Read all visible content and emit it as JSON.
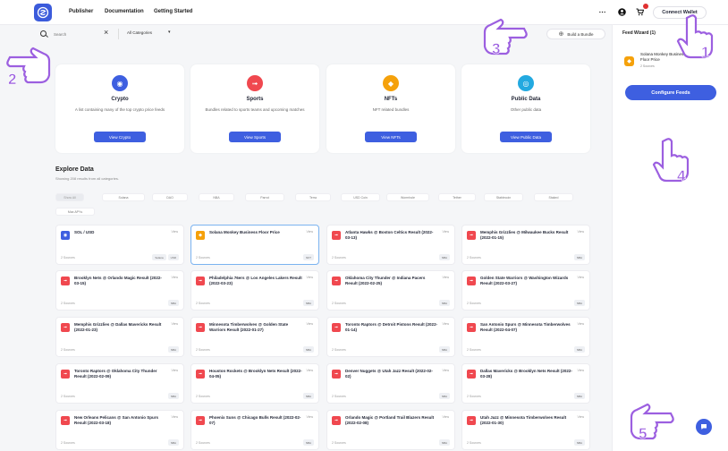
{
  "header": {
    "nav": [
      "Publisher",
      "Documentation",
      "Getting Started"
    ],
    "more_icon": "more-icon",
    "account_icon": "account-icon",
    "cart_icon": "cart-icon",
    "connect_label": "Connect Wallet"
  },
  "search": {
    "placeholder": "Search",
    "category_label": "All Categories"
  },
  "bundle_label": "Build a Bundle",
  "wizard": {
    "title": "Feed Wizard (1)",
    "item_name": "Solana Monkey Business Floor Price",
    "item_sources": "2 Sources",
    "configure_label": "Configure Feeds"
  },
  "categories": [
    {
      "title": "Crypto",
      "desc": "A list containing many of the top crypto price feeds",
      "button": "View Crypto",
      "color": "#3e5fe0",
      "icon": "crypto-icon"
    },
    {
      "title": "Sports",
      "desc": "Bundles related to sports teams and upcoming matches",
      "button": "View Sports",
      "color": "#f0484f",
      "icon": "sports-icon"
    },
    {
      "title": "NFTs",
      "desc": "NFT related bundles",
      "button": "View NFTs",
      "color": "#f5a10b",
      "icon": "nft-icon"
    },
    {
      "title": "Public Data",
      "desc": "Other public data",
      "button": "View Public Data",
      "color": "#23a9e0",
      "icon": "globe-icon"
    }
  ],
  "explore": {
    "title": "Explore Data",
    "subtitle": "Showing 208 results from all categories.",
    "filters": [
      "Show All",
      "Solana",
      "DAO",
      "NBA",
      "Parrot",
      "Terra",
      "USD Coin",
      "Wormhole",
      "Tether",
      "Stablecoin",
      "Staked",
      "Max APYs"
    ]
  },
  "cards": [
    {
      "name": "SOL / USD",
      "sources": "2 Sources",
      "tags": [
        "Solana",
        "USD"
      ],
      "color": "#3e5fe0",
      "selected": false
    },
    {
      "name": "Solana Monkey Business Floor Price",
      "sources": "2 Sources",
      "tags": [
        "NFT"
      ],
      "color": "#f5a10b",
      "selected": true
    },
    {
      "name": "Atlanta Hawks @ Boston Celtics Result (2022-03-13)",
      "sources": "2 Sources",
      "tags": [
        "NBA"
      ],
      "color": "#f0484f",
      "selected": false
    },
    {
      "name": "Memphis Grizzlies @ Milwaukee Bucks Result (2022-01-15)",
      "sources": "2 Sources",
      "tags": [
        "NBA"
      ],
      "color": "#f0484f",
      "selected": false
    },
    {
      "name": "Brooklyn Nets @ Orlando Magic Result (2022-03-15)",
      "sources": "2 Sources",
      "tags": [
        "NBA"
      ],
      "color": "#f0484f",
      "selected": false
    },
    {
      "name": "Philadelphia 76ers @ Los Angeles Lakers Result (2022-03-23)",
      "sources": "2 Sources",
      "tags": [
        "NBA"
      ],
      "color": "#f0484f",
      "selected": false
    },
    {
      "name": "Oklahoma City Thunder @ Indiana Pacers Result (2022-02-25)",
      "sources": "2 Sources",
      "tags": [
        "NBA"
      ],
      "color": "#f0484f",
      "selected": false
    },
    {
      "name": "Golden State Warriors @ Washington Wizards Result (2022-03-27)",
      "sources": "2 Sources",
      "tags": [
        "NBA"
      ],
      "color": "#f0484f",
      "selected": false
    },
    {
      "name": "Memphis Grizzlies @ Dallas Mavericks Result (2022-01-23)",
      "sources": "2 Sources",
      "tags": [
        "NBA"
      ],
      "color": "#f0484f",
      "selected": false
    },
    {
      "name": "Minnesota Timberwolves @ Golden State Warriors Result (2022-01-27)",
      "sources": "2 Sources",
      "tags": [
        "NBA"
      ],
      "color": "#f0484f",
      "selected": false
    },
    {
      "name": "Toronto Raptors @ Detroit Pistons Result (2022-01-14)",
      "sources": "2 Sources",
      "tags": [
        "NBA"
      ],
      "color": "#f0484f",
      "selected": false
    },
    {
      "name": "San Antonio Spurs @ Minnesota Timberwolves Result (2022-04-07)",
      "sources": "2 Sources",
      "tags": [
        "NBA"
      ],
      "color": "#f0484f",
      "selected": false
    },
    {
      "name": "Toronto Raptors @ Oklahoma City Thunder Result (2022-02-09)",
      "sources": "2 Sources",
      "tags": [
        "NBA"
      ],
      "color": "#f0484f",
      "selected": false
    },
    {
      "name": "Houston Rockets @ Brooklyn Nets Result (2022-04-05)",
      "sources": "2 Sources",
      "tags": [
        "NBA"
      ],
      "color": "#f0484f",
      "selected": false
    },
    {
      "name": "Denver Nuggets @ Utah Jazz Result (2022-02-02)",
      "sources": "2 Sources",
      "tags": [
        "NBA"
      ],
      "color": "#f0484f",
      "selected": false
    },
    {
      "name": "Dallas Mavericks @ Brooklyn Nets Result (2022-03-28)",
      "sources": "2 Sources",
      "tags": [
        "NBA"
      ],
      "color": "#f0484f",
      "selected": false
    },
    {
      "name": "New Orleans Pelicans @ San Antonio Spurs Result (2022-03-18)",
      "sources": "2 Sources",
      "tags": [
        "NBA"
      ],
      "color": "#f0484f",
      "selected": false
    },
    {
      "name": "Phoenix Suns @ Chicago Bulls Result (2022-02-07)",
      "sources": "2 Sources",
      "tags": [
        "NBA"
      ],
      "color": "#f0484f",
      "selected": false
    },
    {
      "name": "Orlando Magic @ Portland Trail Blazers Result (2022-02-08)",
      "sources": "2 Sources",
      "tags": [
        "NBA"
      ],
      "color": "#f0484f",
      "selected": false
    },
    {
      "name": "Utah Jazz @ Minnesota Timberwolves Result (2022-01-30)",
      "sources": "2 Sources",
      "tags": [
        "NBA"
      ],
      "color": "#f0484f",
      "selected": false
    }
  ],
  "view_label": "View",
  "hints": [
    {
      "number": "1",
      "direction": "up"
    },
    {
      "number": "2",
      "direction": "left"
    },
    {
      "number": "3",
      "direction": "right"
    },
    {
      "number": "4",
      "direction": "up"
    },
    {
      "number": "5",
      "direction": "right"
    }
  ],
  "hint_color": "#9c5fe0"
}
